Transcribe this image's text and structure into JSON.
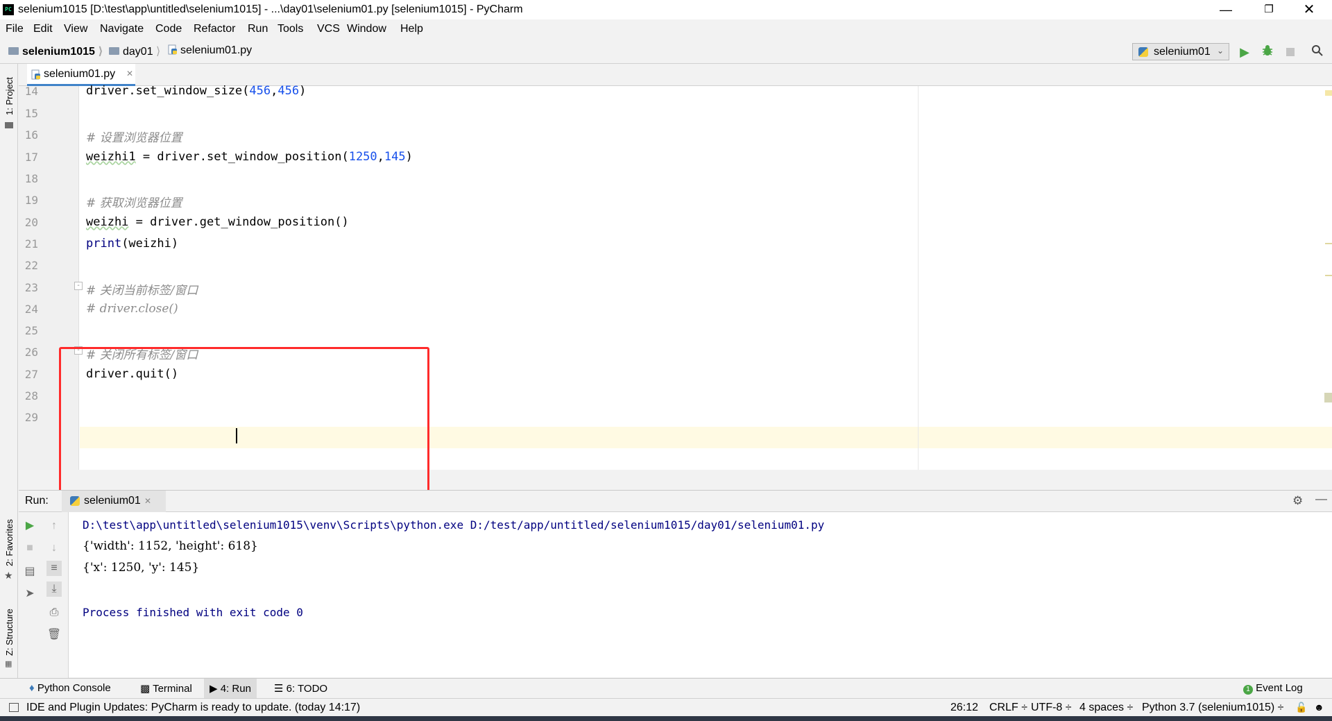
{
  "window": {
    "title": "selenium1015 [D:\\test\\app\\untitled\\selenium1015] - ...\\day01\\selenium01.py [selenium1015] - PyCharm",
    "icon_text": "PC"
  },
  "menu": [
    "File",
    "Edit",
    "View",
    "Navigate",
    "Code",
    "Refactor",
    "Run",
    "Tools",
    "VCS",
    "Window",
    "Help"
  ],
  "breadcrumb": {
    "project": "selenium1015",
    "folder": "day01",
    "file": "selenium01.py"
  },
  "run_config": {
    "label": "selenium01"
  },
  "side_tabs": {
    "project": "1: Project",
    "favorites": "2: Favorites",
    "structure": "Z: Structure"
  },
  "editor": {
    "tab_label": "selenium01.py",
    "lines": [
      {
        "n": "14",
        "code": "driver.set_window_size(456,456)"
      },
      {
        "n": "15",
        "code": ""
      },
      {
        "n": "16",
        "code": "# 设置浏览器位置"
      },
      {
        "n": "17",
        "code": "weizhi1 = driver.set_window_position(1250,145)"
      },
      {
        "n": "18",
        "code": ""
      },
      {
        "n": "19",
        "code": "# 获取浏览器位置"
      },
      {
        "n": "20",
        "code": "weizhi = driver.get_window_position()"
      },
      {
        "n": "21",
        "code": "print(weizhi)"
      },
      {
        "n": "22",
        "code": ""
      },
      {
        "n": "23",
        "code": "# 关闭当前标签/窗口"
      },
      {
        "n": "24",
        "code": "# driver.close()"
      },
      {
        "n": "25",
        "code": ""
      },
      {
        "n": "26",
        "code": "# 关闭所有标签/窗口"
      },
      {
        "n": "27",
        "code": "driver.quit()"
      },
      {
        "n": "28",
        "code": ""
      },
      {
        "n": "29",
        "code": ""
      }
    ]
  },
  "run_panel": {
    "label": "Run:",
    "tab_label": "selenium01",
    "output": [
      "D:\\test\\app\\untitled\\selenium1015\\venv\\Scripts\\python.exe D:/test/app/untitled/selenium1015/day01/selenium01.py",
      "{'width': 1152, 'height': 618}",
      "{'x': 1250, 'y': 145}",
      "",
      "Process finished with exit code 0"
    ]
  },
  "bottom_tabs": {
    "python_console": "Python Console",
    "terminal": "Terminal",
    "run": "4: Run",
    "todo": "6: TODO",
    "event_log": "Event Log"
  },
  "status": {
    "message": "IDE and Plugin Updates: PyCharm is ready to update. (today 14:17)",
    "position": "26:12",
    "line_sep": "CRLF ÷",
    "encoding": "UTF-8 ÷",
    "indent": "4 spaces ÷",
    "interpreter": "Python 3.7 (selenium1015) ÷"
  },
  "colors": {
    "accent": "#4083c9",
    "highlight_box": "#ff2b2b",
    "current_line": "#fffae3",
    "output_text": "#000080"
  }
}
